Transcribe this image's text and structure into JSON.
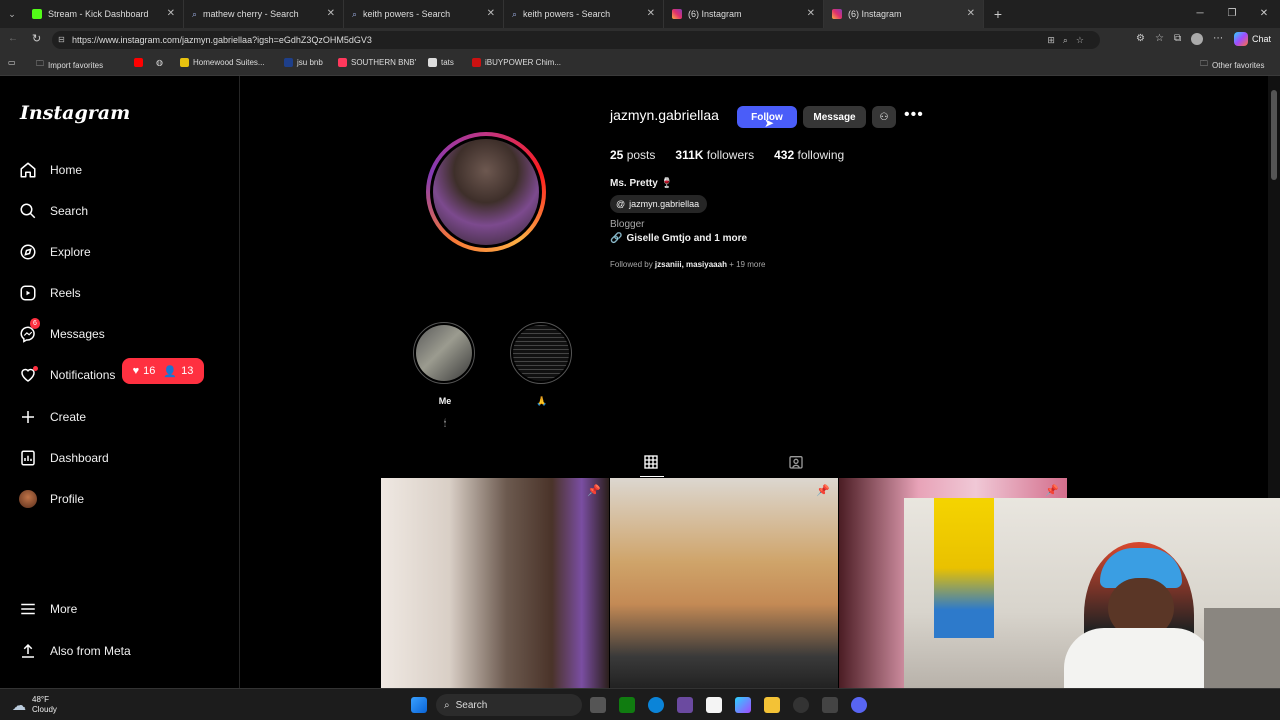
{
  "browser": {
    "tabs": [
      {
        "title": "Stream - Kick Dashboard"
      },
      {
        "title": "mathew cherry - Search"
      },
      {
        "title": "keith powers - Search"
      },
      {
        "title": "keith powers - Search"
      },
      {
        "title": "(6) Instagram"
      },
      {
        "title": "(6) Instagram"
      }
    ],
    "url": "https://www.instagram.com/jazmyn.gabriellaa?igsh=eGdhZ3QzOHM5dGV3",
    "chat_label": "Chat",
    "favorites": [
      {
        "label": "Import favorites"
      },
      {
        "label": "Homewood Suites..."
      },
      {
        "label": "jsu bnb"
      },
      {
        "label": "SOUTHERN BNB'"
      },
      {
        "label": "tats"
      },
      {
        "label": "iBUYPOWER Chim..."
      }
    ],
    "other_favorites": "Other favorites"
  },
  "sidebar": {
    "logo": "Instagram",
    "items": [
      {
        "label": "Home",
        "icon": "home-icon"
      },
      {
        "label": "Search",
        "icon": "search-icon"
      },
      {
        "label": "Explore",
        "icon": "compass-icon"
      },
      {
        "label": "Reels",
        "icon": "reels-icon"
      },
      {
        "label": "Messages",
        "icon": "messenger-icon"
      },
      {
        "label": "Notifications",
        "icon": "heart-icon"
      },
      {
        "label": "Create",
        "icon": "plus-icon"
      },
      {
        "label": "Dashboard",
        "icon": "dashboard-icon"
      },
      {
        "label": "Profile",
        "icon": "avatar"
      }
    ],
    "messages_badge": "6",
    "notif_likes": "16",
    "notif_follows": "13",
    "more": "More",
    "also_meta": "Also from Meta"
  },
  "profile": {
    "username": "jazmyn.gabriellaa",
    "follow": "Follow",
    "message": "Message",
    "posts_count": "25",
    "posts_label": "posts",
    "followers_count": "311K",
    "followers_label": "followers",
    "following_count": "432",
    "following_label": "following",
    "display_name": "Ms. Pretty",
    "threads_handle": "jazmyn.gabriellaa",
    "category": "Blogger",
    "link_text": "Giselle Gmtjo and 1 more",
    "followed_by_prefix": "Followed by",
    "followed_by_users": "jzsaniii, masiyaaah",
    "followed_by_more": "+ 19 more",
    "highlights": [
      {
        "label": "Me"
      },
      {
        "label": ""
      }
    ]
  },
  "taskbar": {
    "temp": "48°F",
    "weather": "Cloudy",
    "search": "Search"
  },
  "colors": {
    "follow_blue": "#4a5df9",
    "badge_red": "#ff3040",
    "bg": "#000000"
  }
}
